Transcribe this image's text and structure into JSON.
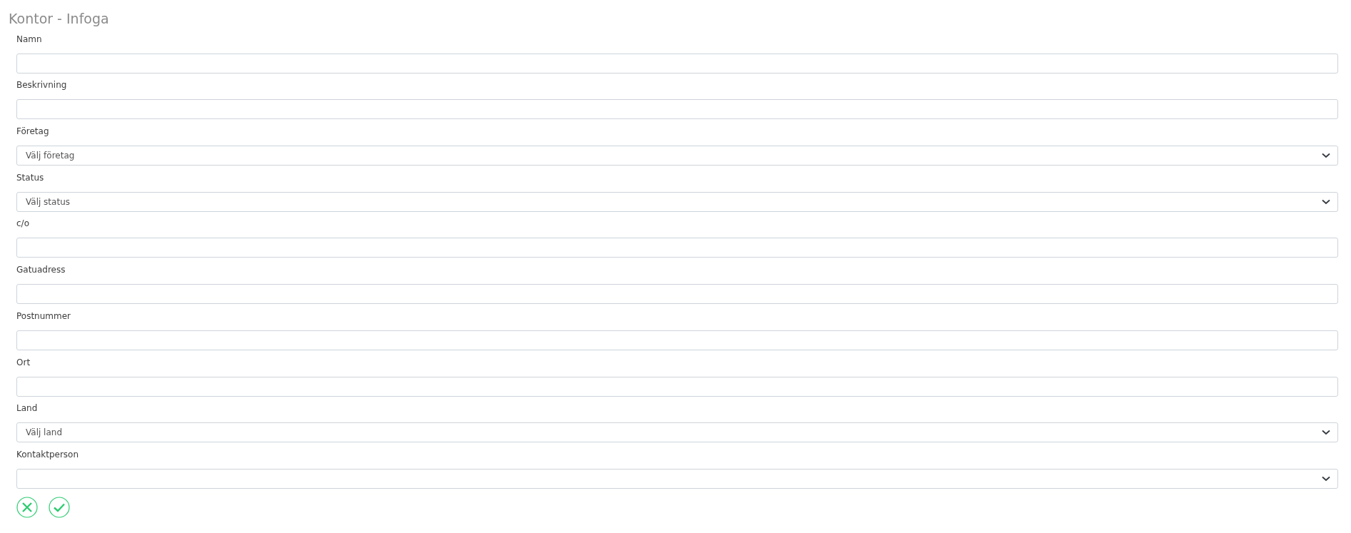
{
  "title": "Kontor - Infoga",
  "fields": [
    {
      "kind": "text",
      "label": "Namn"
    },
    {
      "kind": "text",
      "label": "Beskrivning"
    },
    {
      "kind": "select",
      "label": "Företag",
      "value": "Välj företag"
    },
    {
      "kind": "select",
      "label": "Status",
      "value": "Välj status"
    },
    {
      "kind": "text",
      "label": "c/o"
    },
    {
      "kind": "text",
      "label": "Gatuadress"
    },
    {
      "kind": "text",
      "label": "Postnummer"
    },
    {
      "kind": "text",
      "label": "Ort"
    },
    {
      "kind": "select",
      "label": "Land",
      "value": "Välj land"
    },
    {
      "kind": "select",
      "label": "Kontaktperson"
    }
  ],
  "actions": [
    {
      "kind": "cancel"
    },
    {
      "kind": "confirm"
    }
  ]
}
